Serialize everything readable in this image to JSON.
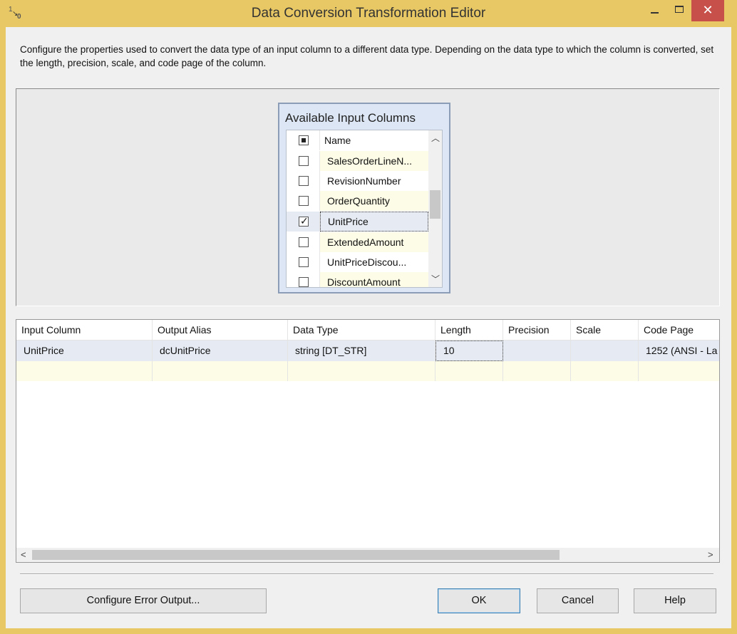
{
  "window": {
    "title": "Data Conversion Transformation Editor",
    "icon": "data-conversion-icon",
    "accent_color": "#e8c864",
    "close_color": "#c7504a",
    "close_glyph": "✕"
  },
  "description": "Configure the properties used to convert the data type of an input column to a different data type. Depending on the data type to which the column is converted, set the length, precision, scale, and code page of the column.",
  "available_columns": {
    "title": "Available Input Columns",
    "header_label": "Name",
    "items": [
      {
        "name": "SalesOrderLineN...",
        "checked": false
      },
      {
        "name": "RevisionNumber",
        "checked": false
      },
      {
        "name": "OrderQuantity",
        "checked": false
      },
      {
        "name": "UnitPrice",
        "checked": true
      },
      {
        "name": "ExtendedAmount",
        "checked": false
      },
      {
        "name": "UnitPriceDiscou...",
        "checked": false
      },
      {
        "name": "DiscountAmount",
        "checked": false
      }
    ]
  },
  "grid": {
    "headers": [
      "Input Column",
      "Output Alias",
      "Data Type",
      "Length",
      "Precision",
      "Scale",
      "Code Page"
    ],
    "rows": [
      [
        "UnitPrice",
        "dcUnitPrice",
        "string [DT_STR]",
        "10",
        "",
        "",
        "1252  (ANSI - La"
      ]
    ]
  },
  "buttons": {
    "configure_error_output": "Configure Error Output...",
    "ok": "OK",
    "cancel": "Cancel",
    "help": "Help"
  }
}
